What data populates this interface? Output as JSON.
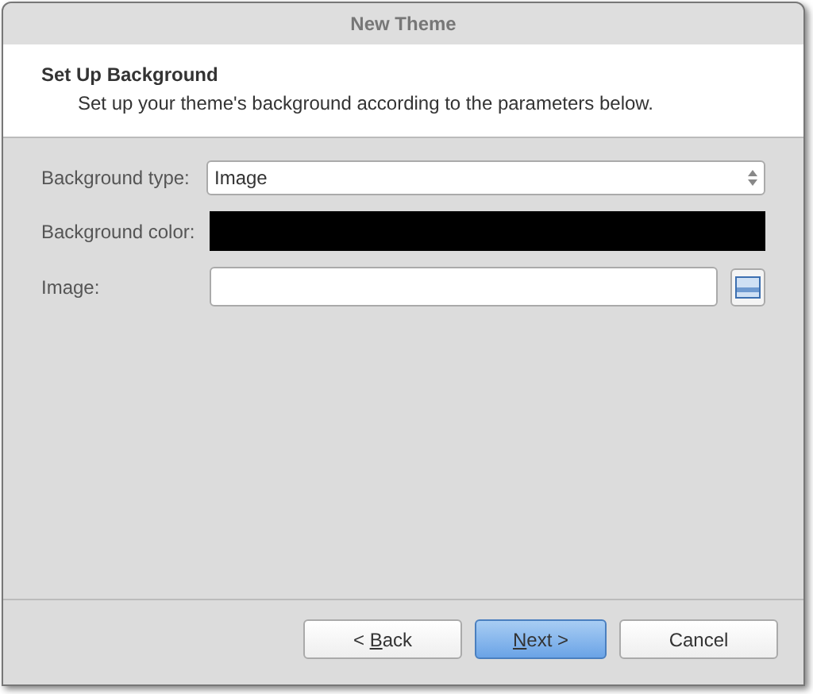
{
  "window": {
    "title": "New Theme"
  },
  "header": {
    "title": "Set Up Background",
    "subtitle": "Set up your theme's background according to the parameters below."
  },
  "form": {
    "background_type": {
      "label": "Background type:",
      "value": "Image"
    },
    "background_color": {
      "label": "Background color:",
      "color": "#000000"
    },
    "image": {
      "label": "Image:"
    }
  },
  "buttons": [
    {
      "before": "< ",
      "mnemonic": "B",
      "after": "ack",
      "default": false
    },
    {
      "mnemonic": "N",
      "after": "ext >",
      "default": true
    },
    {
      "before": "Cancel",
      "default": false
    }
  ]
}
